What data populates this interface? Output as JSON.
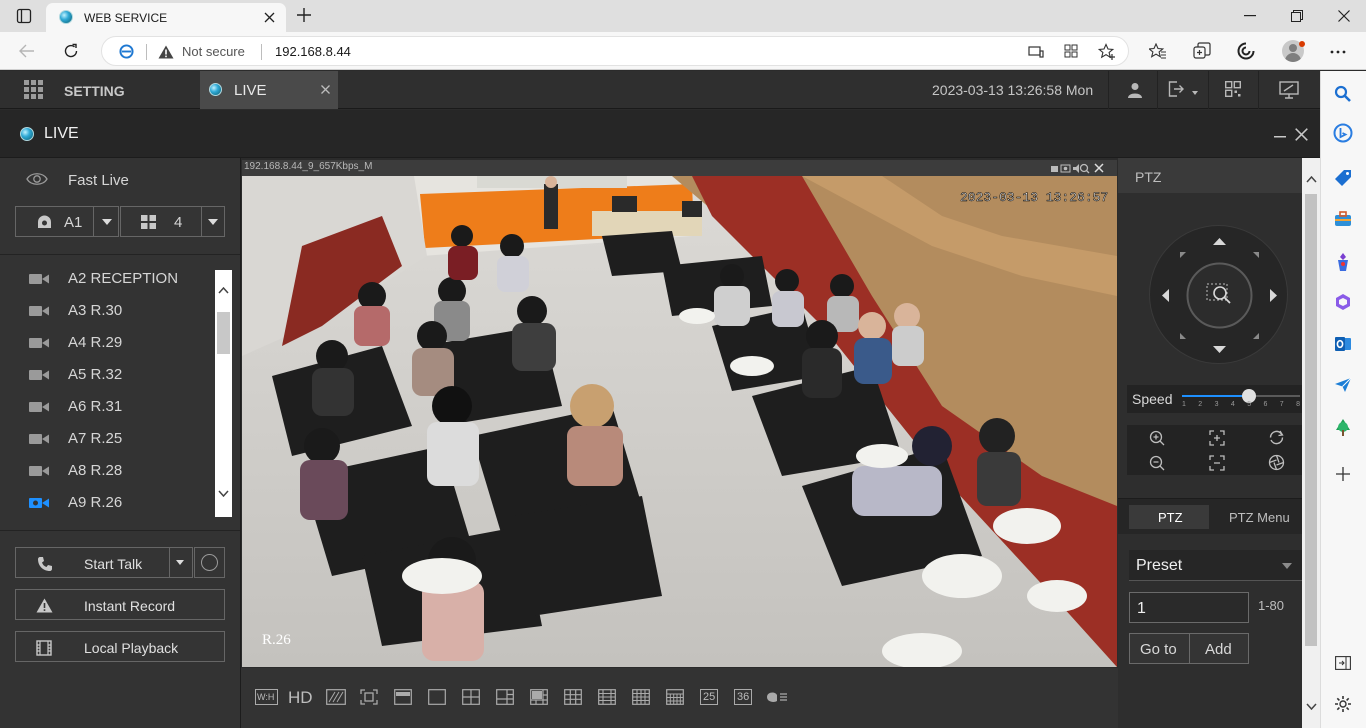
{
  "browser": {
    "tab_title": "WEB SERVICE",
    "security_label": "Not secure",
    "url": "192.168.8.44"
  },
  "app": {
    "setting_label": "SETTING",
    "live_tab_label": "LIVE",
    "datetime": "2023-03-13 13:26:58 Mon",
    "section_title": "LIVE"
  },
  "left_panel": {
    "fast_live_label": "Fast Live",
    "channel_select": "A1",
    "layout_select": "4",
    "cameras": [
      {
        "label": "A2 RECEPTION",
        "active": false
      },
      {
        "label": "A3 R.30",
        "active": false
      },
      {
        "label": "A4 R.29",
        "active": false
      },
      {
        "label": "A5 R.32",
        "active": false
      },
      {
        "label": "A6 R.31",
        "active": false
      },
      {
        "label": "A7 R.25",
        "active": false
      },
      {
        "label": "A8 R.28",
        "active": false
      },
      {
        "label": "A9 R.26",
        "active": true
      }
    ],
    "start_talk_label": "Start Talk",
    "instant_record_label": "Instant Record",
    "local_playback_label": "Local Playback"
  },
  "video": {
    "stream_info": "192.168.8.44_9_657Kbps_M",
    "osd_timestamp": "2023-03-13 13:26:57",
    "osd_channel": "R.26"
  },
  "toolbar": {
    "hd_label": "HD",
    "wh_label": "W:H",
    "layout_25": "25",
    "layout_36": "36"
  },
  "ptz": {
    "title": "PTZ",
    "speed_label": "Speed",
    "speed_ticks": [
      "1",
      "2",
      "3",
      "4",
      "5",
      "6",
      "7",
      "8"
    ],
    "speed_value": 5,
    "tab_ptz": "PTZ",
    "tab_ptz_menu": "PTZ Menu",
    "mode_select": "Preset",
    "preset_value": "1",
    "preset_range": "1-80",
    "goto_label": "Go to",
    "add_label": "Add"
  },
  "colors": {
    "accent_blue": "#1e90ff",
    "panel_dark": "#333333",
    "header_dark": "#2f2f2f"
  }
}
